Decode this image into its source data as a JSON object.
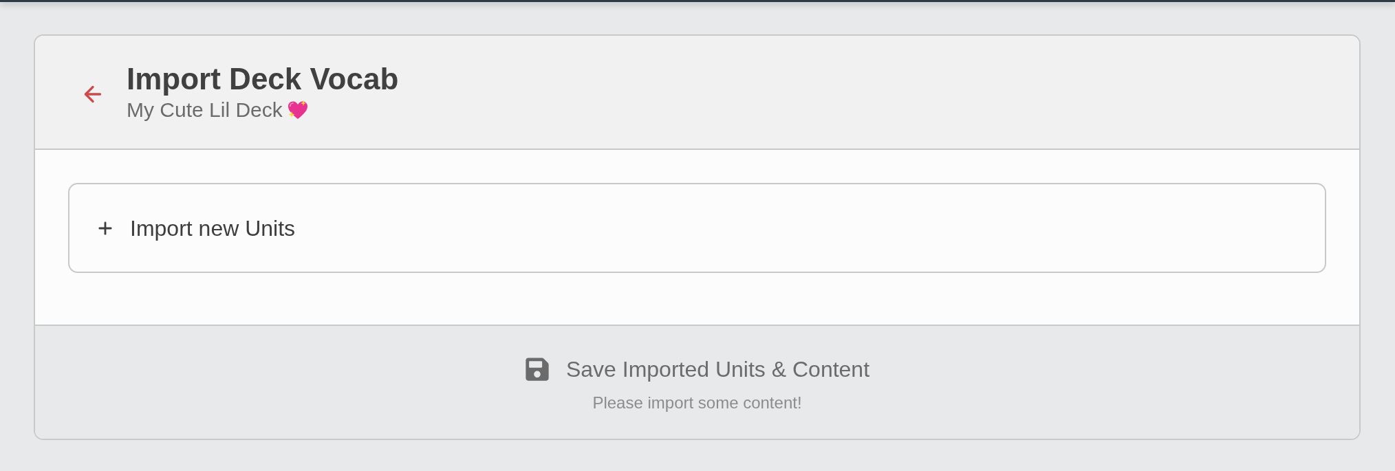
{
  "header": {
    "title": "Import Deck Vocab",
    "subtitle": "My Cute Lil Deck"
  },
  "import_panel": {
    "label": "Import new Units"
  },
  "footer": {
    "save_button": {
      "label": "Save Imported Units & Content",
      "disabled": true
    },
    "hint": "Please import some content!"
  }
}
